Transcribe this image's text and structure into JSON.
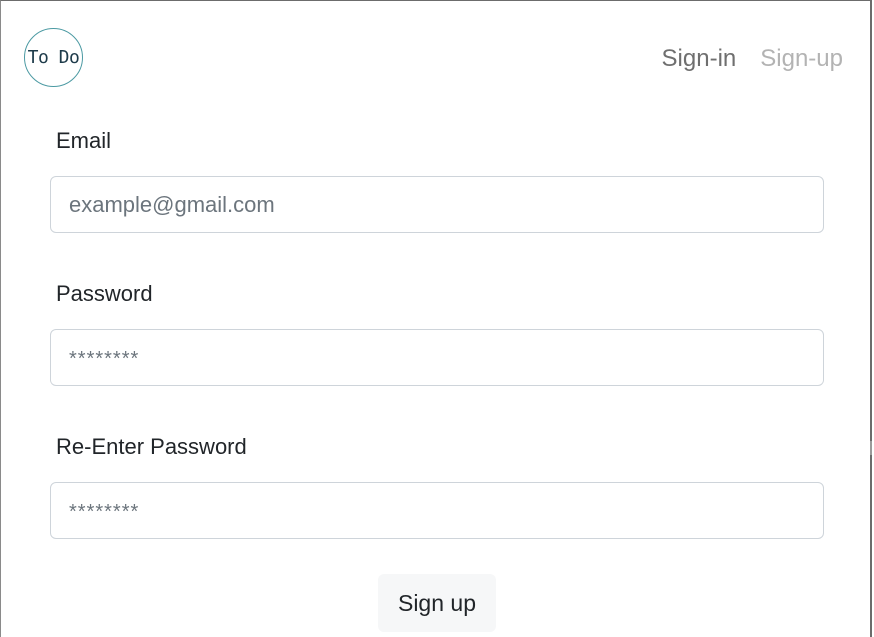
{
  "header": {
    "logo_text": "To Do",
    "nav": {
      "signin_label": "Sign-in",
      "signup_label": "Sign-up"
    }
  },
  "form": {
    "email": {
      "label": "Email",
      "placeholder": "example@gmail.com",
      "value": ""
    },
    "password": {
      "label": "Password",
      "placeholder": "********",
      "value": ""
    },
    "confirm_password": {
      "label": "Re-Enter Password",
      "placeholder": "********",
      "value": ""
    },
    "submit_label": "Sign up"
  },
  "colors": {
    "logo_border": "#4c9aa3",
    "nav_active": "#6f6f6f",
    "nav_inactive": "#b3b3b3",
    "input_border": "#ced4da",
    "button_bg": "#f6f7f8"
  }
}
